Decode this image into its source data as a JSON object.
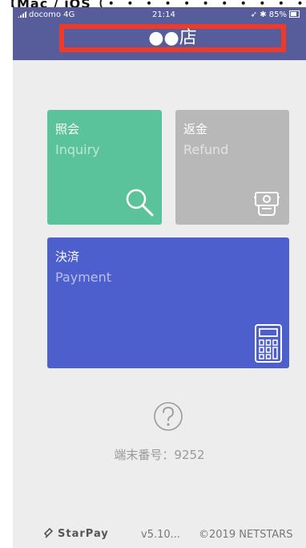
{
  "caption": {
    "text": "【Mac / iOS（・ ・ ・ ・ ・ ・ ・ ・ ・ ・ ・）】"
  },
  "status_bar": {
    "carrier": "docomo 4G",
    "time": "21:14",
    "battery": "85%"
  },
  "header": {
    "title": "●●店",
    "highlight_color": "#ee3a2a"
  },
  "tiles": {
    "inquiry": {
      "label_jp": "照会",
      "label_en": "Inquiry",
      "color": "#5bc39c",
      "icon": "magnifier-icon"
    },
    "refund": {
      "label_jp": "返金",
      "label_en": "Refund",
      "color": "#b8b8b8",
      "icon": "refund-icon"
    },
    "payment": {
      "label_jp": "決済",
      "label_en": "Payment",
      "color": "#4c5fcc",
      "icon": "calculator-icon"
    }
  },
  "help": {
    "icon": "help-circle-icon"
  },
  "terminal": {
    "text": "端末番号：9252"
  },
  "footer": {
    "brand": "StarPay",
    "version": "v5.10...",
    "copyright": "©2019 NETSTARS"
  }
}
